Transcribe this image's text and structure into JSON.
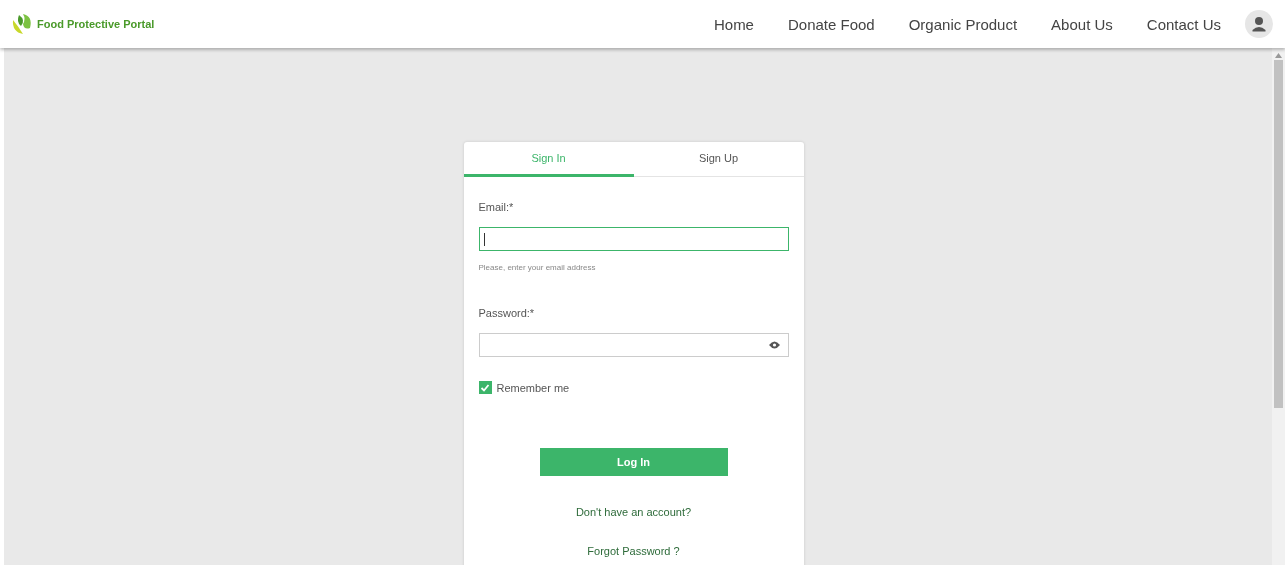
{
  "header": {
    "brand": "Food Protective Portal",
    "nav": [
      {
        "label": "Home"
      },
      {
        "label": "Donate Food"
      },
      {
        "label": "Organic Product"
      },
      {
        "label": "About Us"
      },
      {
        "label": "Contact Us"
      }
    ]
  },
  "auth_card": {
    "tabs": [
      {
        "label": "Sign In",
        "selected": true
      },
      {
        "label": "Sign Up",
        "selected": false
      }
    ],
    "email": {
      "label": "Email:*",
      "focused": true,
      "hint": "Please, enter your email address"
    },
    "password": {
      "label": "Password:*"
    },
    "remember": {
      "label": "Remember me",
      "checked": true
    },
    "login_button": "Log In",
    "links": [
      "Don't have an account?",
      "Forgot Password ?"
    ]
  }
}
